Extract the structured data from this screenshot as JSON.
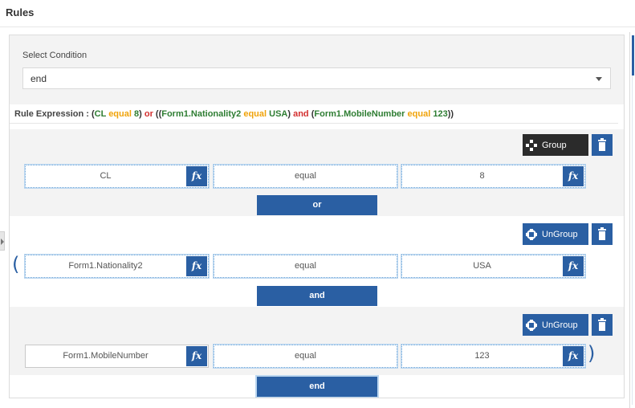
{
  "title": "Rules",
  "select_condition": {
    "label": "Select Condition",
    "value": "end"
  },
  "expression": {
    "label": "Rule Expression :",
    "c1_field": "CL",
    "c1_op": "equal",
    "c1_value": "8",
    "join1": "or",
    "c2_field": "Form1.Nationality2",
    "c2_op": "equal",
    "c2_value": "USA",
    "join2": "and",
    "c3_field": "Form1.MobileNumber",
    "c3_op": "equal",
    "c3_value": "123"
  },
  "rows": [
    {
      "group_label": "Group",
      "field": "CL",
      "operator": "equal",
      "value": "8",
      "join": "or",
      "open_paren": "",
      "close_paren": ""
    },
    {
      "group_label": "UnGroup",
      "field": "Form1.Nationality2",
      "operator": "equal",
      "value": "USA",
      "join": "and",
      "open_paren": "(",
      "close_paren": ""
    },
    {
      "group_label": "UnGroup",
      "field": "Form1.MobileNumber",
      "operator": "equal",
      "value": "123",
      "join": "end",
      "open_paren": "",
      "close_paren": ")"
    }
  ],
  "fx_label": "fx",
  "icons": {
    "group": "group-icon",
    "ungroup": "ungroup-icon",
    "trash": "trash-icon",
    "caret": "chevron-down-icon"
  },
  "colors": {
    "primary": "#2a5fa3",
    "dark_button": "#2b2b2b",
    "field_text": "#2e7d32",
    "operator_text": "#f0a30a",
    "join_text": "#d32f2f"
  }
}
